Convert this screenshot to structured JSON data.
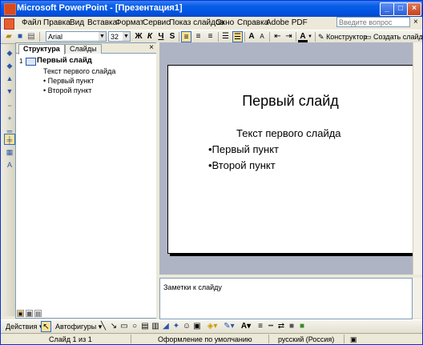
{
  "window": {
    "title": "Microsoft PowerPoint - [Презентация1]"
  },
  "menu": [
    "Файл",
    "Правка",
    "Вид",
    "Вставка",
    "Формат",
    "Сервис",
    "Показ слайдов",
    "Окно",
    "Справка",
    "Adobe PDF"
  ],
  "ask_placeholder": "Введите вопрос",
  "toolbar": {
    "font": "Arial",
    "size": "32",
    "bold": "Ж",
    "italic": "К",
    "underline": "Ч",
    "shadow": "S",
    "grow_font": "A",
    "shrink_font": "A",
    "font_color": "A",
    "designer": "Конструктор",
    "new_slide": "Создать слайд"
  },
  "panel": {
    "tab_outline": "Структура",
    "tab_slides": "Слайды",
    "close": "×"
  },
  "outline": {
    "slide_number": "1",
    "title": "Первый слайд",
    "subtitle": "Текст первого слайда",
    "bullets": [
      "• Первый пункт",
      "• Второй пункт"
    ]
  },
  "slide": {
    "title": "Первый слайд",
    "subtitle": "Текст первого слайда",
    "bullets": [
      "•Первый пункт",
      "•Второй пункт"
    ]
  },
  "notes_placeholder": "Заметки к слайду",
  "drawing": {
    "actions": "Действия",
    "autoshapes": "Автофигуры"
  },
  "status": {
    "slide": "Слайд 1 из 1",
    "design": "Оформление по умолчанию",
    "language": "русский (Россия)"
  }
}
